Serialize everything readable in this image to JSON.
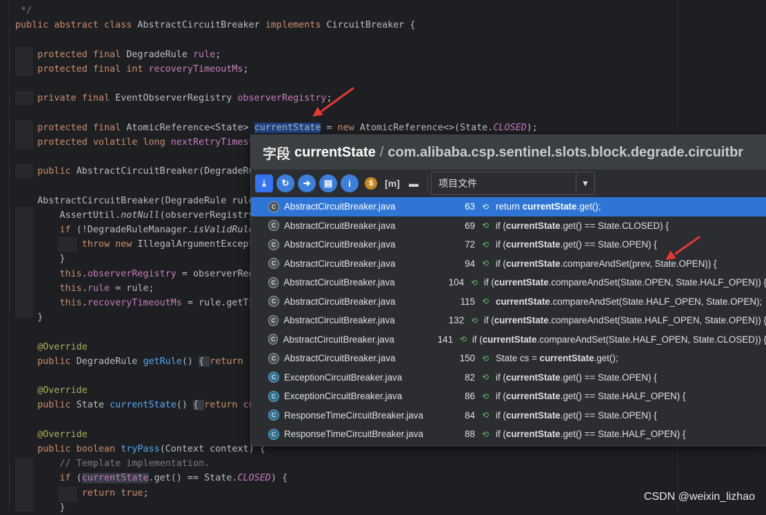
{
  "editor": {
    "lines": [
      {
        "parts": [
          {
            "t": " */",
            "c": "cmt"
          }
        ]
      },
      {
        "parts": [
          {
            "t": "public abstract class ",
            "c": "kw"
          },
          {
            "t": "AbstractCircuitBreaker ",
            "c": "cls"
          },
          {
            "t": "implements ",
            "c": "kw"
          },
          {
            "t": "CircuitBreaker {",
            "c": "cls"
          }
        ]
      },
      {
        "parts": []
      },
      {
        "parts": [
          {
            "t": "    protected final ",
            "c": "kw"
          },
          {
            "t": "DegradeRule ",
            "c": "cls"
          },
          {
            "t": "rule",
            "c": "fld"
          },
          {
            "t": ";",
            "c": "cls"
          }
        ]
      },
      {
        "parts": [
          {
            "t": "    protected final int ",
            "c": "kw"
          },
          {
            "t": "recoveryTimeoutMs",
            "c": "fld"
          },
          {
            "t": ";",
            "c": "cls"
          }
        ]
      },
      {
        "parts": []
      },
      {
        "parts": [
          {
            "t": "    private final ",
            "c": "kw"
          },
          {
            "t": "EventObserverRegistry ",
            "c": "cls"
          },
          {
            "t": "observerRegistry",
            "c": "fld"
          },
          {
            "t": ";",
            "c": "cls"
          }
        ]
      },
      {
        "parts": []
      },
      {
        "parts": [
          {
            "t": "    protected final ",
            "c": "kw"
          },
          {
            "t": "AtomicReference<State> ",
            "c": "cls"
          },
          {
            "t": "currentState",
            "c": "hl"
          },
          {
            "t": " = ",
            "c": "cls"
          },
          {
            "t": "new ",
            "c": "kw"
          },
          {
            "t": "AtomicReference<>(State.",
            "c": "cls"
          },
          {
            "t": "CLOSED",
            "c": "fld it"
          },
          {
            "t": ");",
            "c": "cls"
          }
        ]
      },
      {
        "parts": [
          {
            "t": "    protected volatile long ",
            "c": "kw"
          },
          {
            "t": "nextRetryTimest",
            "c": "fld"
          }
        ]
      },
      {
        "parts": []
      },
      {
        "parts": [
          {
            "t": "    public ",
            "c": "kw"
          },
          {
            "t": "AbstractCircuitBreaker(DegradeRu",
            "c": "cls"
          }
        ]
      },
      {
        "parts": []
      },
      {
        "parts": [
          {
            "t": "    AbstractCircuitBreaker(DegradeRule rule",
            "c": "cls"
          }
        ]
      },
      {
        "parts": [
          {
            "t": "        AssertUtil.",
            "c": "cls"
          },
          {
            "t": "notNull",
            "c": "it"
          },
          {
            "t": "(observerRegistry",
            "c": "cls"
          }
        ]
      },
      {
        "parts": [
          {
            "t": "        if ",
            "c": "kw"
          },
          {
            "t": "(!DegradeRuleManager.",
            "c": "cls"
          },
          {
            "t": "isValidRule",
            "c": "it"
          }
        ]
      },
      {
        "parts": [
          {
            "t": "            throw new ",
            "c": "kw"
          },
          {
            "t": "IllegalArgumentExcept",
            "c": "cls"
          }
        ]
      },
      {
        "parts": [
          {
            "t": "        }",
            "c": "cls"
          }
        ]
      },
      {
        "parts": [
          {
            "t": "        this",
            "c": "kw"
          },
          {
            "t": ".",
            "c": "cls"
          },
          {
            "t": "observerRegistry",
            "c": "fld"
          },
          {
            "t": " = observerReg",
            "c": "cls"
          }
        ]
      },
      {
        "parts": [
          {
            "t": "        this",
            "c": "kw"
          },
          {
            "t": ".",
            "c": "cls"
          },
          {
            "t": "rule",
            "c": "fld"
          },
          {
            "t": " = rule;",
            "c": "cls"
          }
        ]
      },
      {
        "parts": [
          {
            "t": "        this",
            "c": "kw"
          },
          {
            "t": ".",
            "c": "cls"
          },
          {
            "t": "recoveryTimeoutMs",
            "c": "fld"
          },
          {
            "t": " = rule.getTi",
            "c": "cls"
          }
        ]
      },
      {
        "parts": [
          {
            "t": "    }",
            "c": "cls"
          }
        ]
      },
      {
        "parts": []
      },
      {
        "parts": [
          {
            "t": "    @Override",
            "c": "ann"
          }
        ]
      },
      {
        "parts": [
          {
            "t": "    public ",
            "c": "kw"
          },
          {
            "t": "DegradeRule ",
            "c": "cls"
          },
          {
            "t": "getRule",
            "c": "fn"
          },
          {
            "t": "() ",
            "c": "cls"
          },
          {
            "t": "{ ",
            "c": "refhl"
          },
          {
            "t": "return ",
            "c": "kw"
          },
          {
            "t": "r",
            "c": "fld"
          }
        ]
      },
      {
        "parts": []
      },
      {
        "parts": [
          {
            "t": "    @Override",
            "c": "ann"
          }
        ]
      },
      {
        "parts": [
          {
            "t": "    public ",
            "c": "kw"
          },
          {
            "t": "State ",
            "c": "cls"
          },
          {
            "t": "currentState",
            "c": "fn"
          },
          {
            "t": "() ",
            "c": "cls"
          },
          {
            "t": "{ ",
            "c": "refhl"
          },
          {
            "t": "return ",
            "c": "kw"
          },
          {
            "t": "cu",
            "c": "fld"
          }
        ]
      },
      {
        "parts": []
      },
      {
        "parts": [
          {
            "t": "    @Override",
            "c": "ann"
          }
        ]
      },
      {
        "parts": [
          {
            "t": "    public boolean ",
            "c": "kw"
          },
          {
            "t": "tryPass",
            "c": "fn"
          },
          {
            "t": "(Context context) {",
            "c": "cls"
          }
        ]
      },
      {
        "parts": [
          {
            "t": "        // Template implementation.",
            "c": "cmt"
          }
        ]
      },
      {
        "parts": [
          {
            "t": "        if ",
            "c": "kw"
          },
          {
            "t": "(",
            "c": "cls"
          },
          {
            "t": "currentState",
            "c": "fld refhl"
          },
          {
            "t": ".get() == State.",
            "c": "cls"
          },
          {
            "t": "CLOSED",
            "c": "fld it"
          },
          {
            "t": ") {",
            "c": "cls"
          }
        ]
      },
      {
        "parts": [
          {
            "t": "            return true",
            "c": "kw"
          },
          {
            "t": ";",
            "c": "cls"
          }
        ]
      },
      {
        "parts": [
          {
            "t": "        }",
            "c": "cls"
          }
        ]
      }
    ]
  },
  "popup": {
    "kind_label": "字段",
    "symbol_name": "currentState",
    "separator": "/",
    "path": "com.alibaba.csp.sentinel.slots.block.degrade.circuitbr",
    "scope_label": "项目文件",
    "toolbar_icons": [
      "export-icon",
      "navigate-back-icon",
      "navigate-forward-icon",
      "group-by-folder-icon",
      "info-icon",
      "coin-icon",
      "module-icon",
      "preview-icon"
    ],
    "results": [
      {
        "file": "AbstractCircuitBreaker.java",
        "line": "63",
        "kind": "abs",
        "pre": "return ",
        "bold": "currentState",
        "post": ".get();"
      },
      {
        "file": "AbstractCircuitBreaker.java",
        "line": "69",
        "kind": "abs",
        "pre": "if (",
        "bold": "currentState",
        "post": ".get() == State.CLOSED) {"
      },
      {
        "file": "AbstractCircuitBreaker.java",
        "line": "72",
        "kind": "abs",
        "pre": "if (",
        "bold": "currentState",
        "post": ".get() == State.OPEN) {"
      },
      {
        "file": "AbstractCircuitBreaker.java",
        "line": "94",
        "kind": "abs",
        "pre": "if (",
        "bold": "currentState",
        "post": ".compareAndSet(prev, State.OPEN)) {"
      },
      {
        "file": "AbstractCircuitBreaker.java",
        "line": "104",
        "kind": "abs",
        "pre": "if (",
        "bold": "currentState",
        "post": ".compareAndSet(State.OPEN, State.HALF_OPEN)) {"
      },
      {
        "file": "AbstractCircuitBreaker.java",
        "line": "115",
        "kind": "abs",
        "pre": "",
        "bold": "currentState",
        "post": ".compareAndSet(State.HALF_OPEN, State.OPEN);"
      },
      {
        "file": "AbstractCircuitBreaker.java",
        "line": "132",
        "kind": "abs",
        "pre": "if (",
        "bold": "currentState",
        "post": ".compareAndSet(State.HALF_OPEN, State.OPEN)) {"
      },
      {
        "file": "AbstractCircuitBreaker.java",
        "line": "141",
        "kind": "abs",
        "pre": "if (",
        "bold": "currentState",
        "post": ".compareAndSet(State.HALF_OPEN, State.CLOSED)) {"
      },
      {
        "file": "AbstractCircuitBreaker.java",
        "line": "150",
        "kind": "abs",
        "pre": "State cs = ",
        "bold": "currentState",
        "post": ".get();"
      },
      {
        "file": "ExceptionCircuitBreaker.java",
        "line": "82",
        "kind": "cls",
        "pre": "if (",
        "bold": "currentState",
        "post": ".get() == State.OPEN) {"
      },
      {
        "file": "ExceptionCircuitBreaker.java",
        "line": "86",
        "kind": "cls",
        "pre": "if (",
        "bold": "currentState",
        "post": ".get() == State.HALF_OPEN) {"
      },
      {
        "file": "ResponseTimeCircuitBreaker.java",
        "line": "84",
        "kind": "cls",
        "pre": "if (",
        "bold": "currentState",
        "post": ".get() == State.OPEN) {"
      },
      {
        "file": "ResponseTimeCircuitBreaker.java",
        "line": "88",
        "kind": "cls",
        "pre": "if (",
        "bold": "currentState",
        "post": ".get() == State.HALF_OPEN) {"
      }
    ],
    "selected_index": 0
  },
  "watermark": "CSDN @weixin_lizhao",
  "colors": {
    "accent": "#2e75d6",
    "arrow": "#e53935"
  }
}
